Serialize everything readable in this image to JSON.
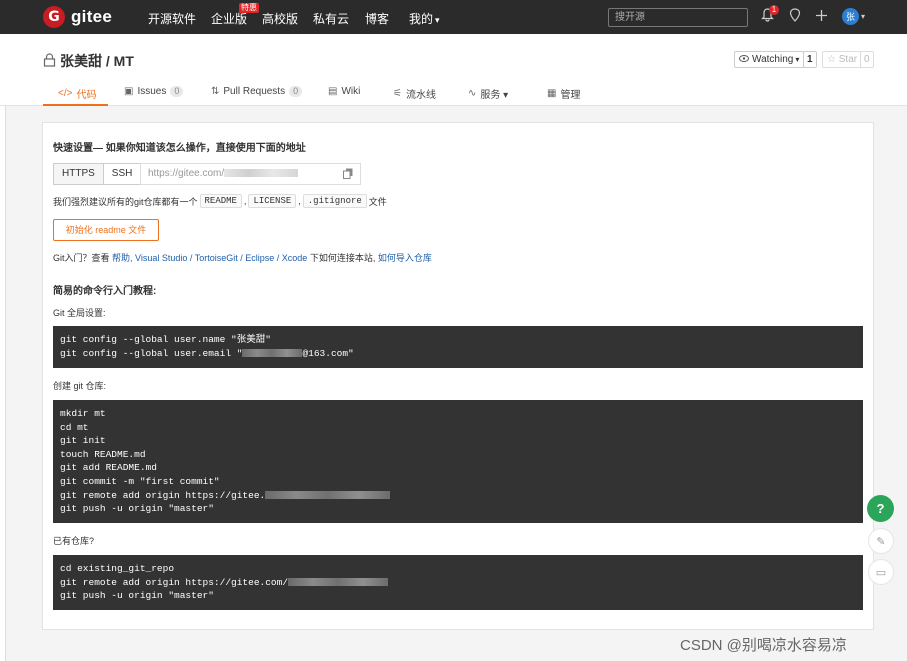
{
  "nav": {
    "logo_text": "gitee",
    "logo_mark": "G",
    "items": [
      "开源软件",
      "企业版",
      "高校版",
      "私有云",
      "博客",
      "我的"
    ],
    "my_caret": "▾",
    "hot_badge": "特惠",
    "search_placeholder": "搜开源",
    "notification_count": "1",
    "avatar_text": "张",
    "icons": [
      "bell-icon",
      "location-icon",
      "plus-icon"
    ]
  },
  "repo": {
    "title": "张美甜 / MT",
    "watch_label": "Watching",
    "watch_caret": "▾",
    "watch_count": "1",
    "star_label": "Star",
    "star_count": "0",
    "tabs": [
      {
        "icon": "</>",
        "label": "代码",
        "count": ""
      },
      {
        "icon": "▣",
        "label": "Issues",
        "count": "0"
      },
      {
        "icon": "⇅",
        "label": "Pull Requests",
        "count": "0"
      },
      {
        "icon": "▤",
        "label": "Wiki",
        "count": ""
      },
      {
        "icon": "⚟",
        "label": "流水线",
        "count": ""
      },
      {
        "icon": "∿",
        "label": "服务 ▾",
        "count": ""
      },
      {
        "icon": "▦",
        "label": "管理",
        "count": ""
      }
    ]
  },
  "quick": {
    "title": "快速设置— 如果你知道该怎么操作，直接使用下面的地址",
    "https": "HTTPS",
    "ssh": "SSH",
    "url_prefix": "https://gitee.com/",
    "recommend_prefix": "我们强烈建议所有的git仓库都有一个",
    "tag_readme": "README",
    "tag_license": "LICENSE",
    "tag_gitignore": ".gitignore",
    "comma": ",",
    "recommend_suffix": "文件",
    "readme_button": "初始化 readme 文件",
    "git_intro_prefix": "Git入门？查看",
    "git_intro_help": "帮助",
    "git_intro_tools": ", Visual Studio / TortoiseGit / Eclipse / Xcode",
    "git_intro_mid": "下如何连接本站,",
    "git_intro_import": "如何导入仓库"
  },
  "tutorial": {
    "title": "简易的命令行入门教程:",
    "global_label": "Git 全局设置:",
    "global_lines": [
      "git config --global user.name \"张美甜\"",
      "git config --global user.email \"",
      "@163.com\""
    ],
    "create_label": "创建 git 仓库:",
    "create_lines": [
      "mkdir mt",
      "cd mt",
      "git init",
      "touch README.md",
      "git add README.md",
      "git commit -m \"first commit\"",
      "git remote add origin https://gitee.",
      "git push -u origin \"master\""
    ],
    "existing_label": "已有仓库?",
    "existing_lines": [
      "cd existing_git_repo",
      "git remote add origin https://gitee.com/",
      "git push -u origin \"master\""
    ]
  },
  "floating": {
    "help": "?",
    "edit_icon": "✎",
    "chat_icon": "▭"
  },
  "watermark": "CSDN @别喝凉水容易凉"
}
